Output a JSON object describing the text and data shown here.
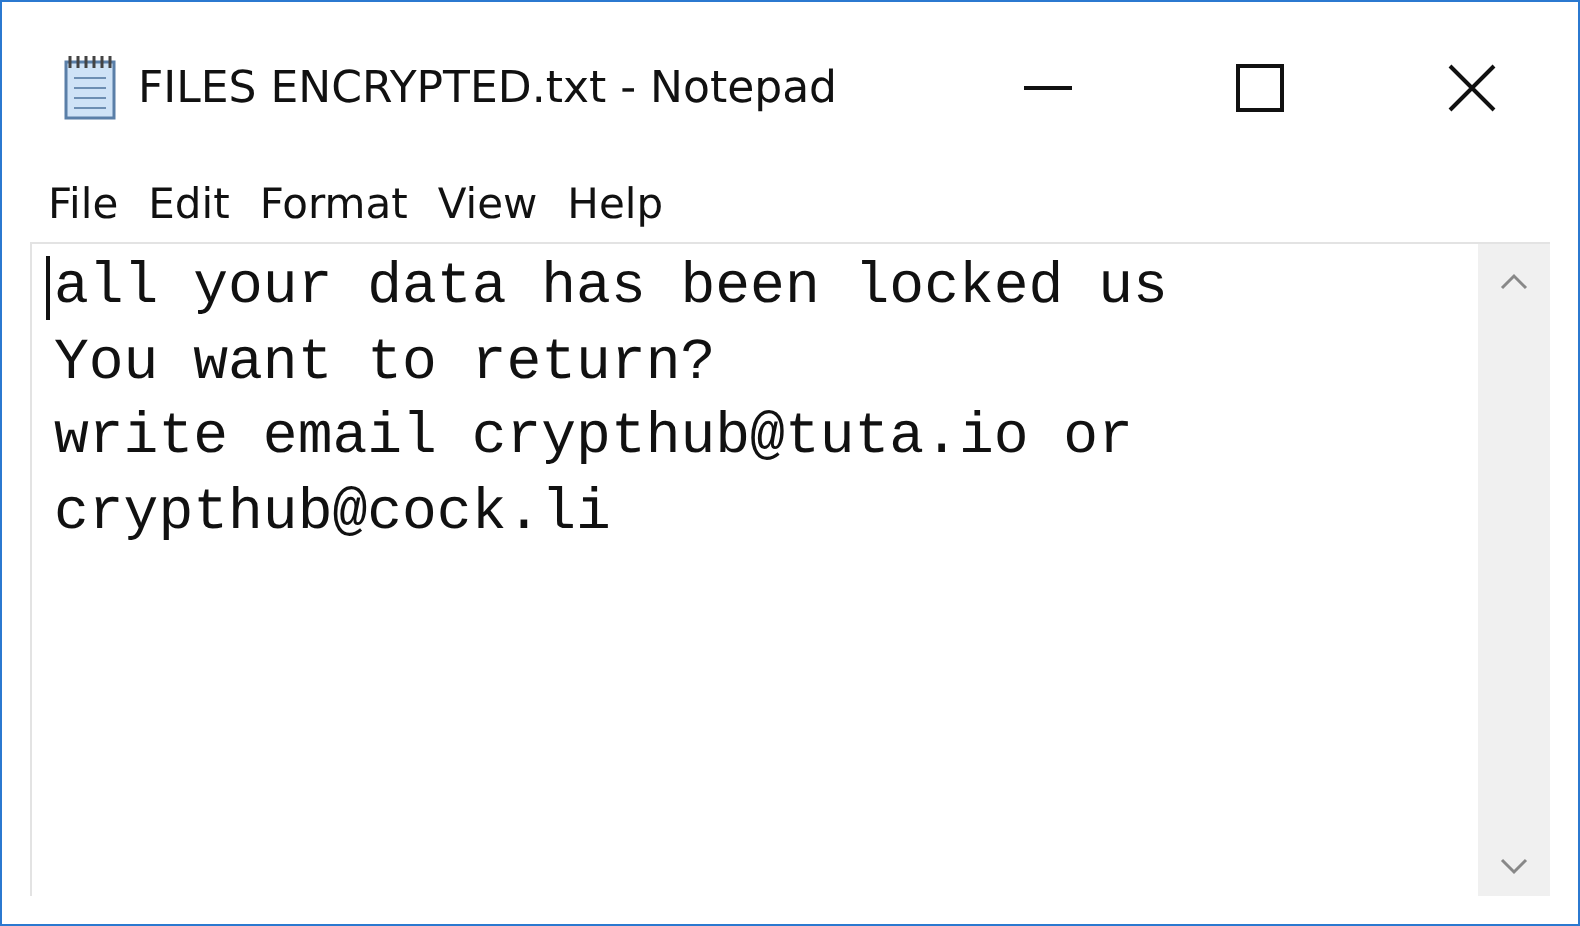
{
  "window": {
    "title": "FILES ENCRYPTED.txt - Notepad"
  },
  "menu": [
    {
      "label": "File"
    },
    {
      "label": "Edit"
    },
    {
      "label": "Format"
    },
    {
      "label": "View"
    },
    {
      "label": "Help"
    }
  ],
  "editor": {
    "lines": [
      "all your data has been locked us",
      "You want to return?",
      "write email crypthub@tuta.io or",
      "crypthub@cock.li"
    ]
  }
}
